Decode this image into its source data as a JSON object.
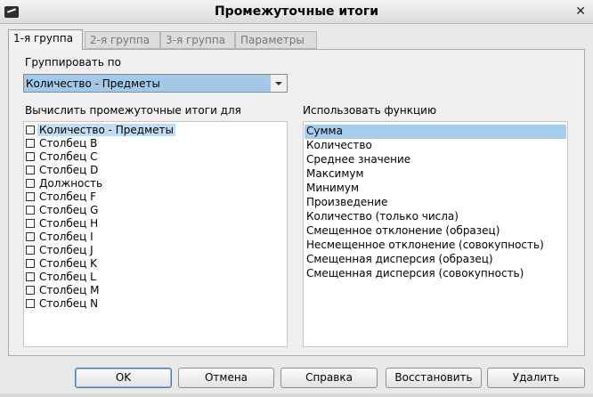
{
  "window": {
    "title": "Промежуточные итоги"
  },
  "tabs": [
    {
      "label": "1-я группа",
      "active": true
    },
    {
      "label": "2-я группа",
      "active": false
    },
    {
      "label": "3-я группа",
      "active": false
    },
    {
      "label": "Параметры",
      "active": false
    }
  ],
  "group_by": {
    "label": "Группировать по",
    "value": "Количество - Предметы"
  },
  "columns": {
    "label": "Вычислить промежуточные итоги для",
    "items": [
      {
        "label": "Количество - Предметы",
        "checked": false,
        "selected": true
      },
      {
        "label": "Столбец B",
        "checked": false
      },
      {
        "label": "Столбец C",
        "checked": false
      },
      {
        "label": "Столбец D",
        "checked": false
      },
      {
        "label": "Должность",
        "checked": false
      },
      {
        "label": "Столбец F",
        "checked": false
      },
      {
        "label": "Столбец G",
        "checked": false
      },
      {
        "label": "Столбец H",
        "checked": false
      },
      {
        "label": "Столбец I",
        "checked": false
      },
      {
        "label": "Столбец J",
        "checked": false
      },
      {
        "label": "Столбец K",
        "checked": false
      },
      {
        "label": "Столбец L",
        "checked": false
      },
      {
        "label": "Столбец M",
        "checked": false
      },
      {
        "label": "Столбец N",
        "checked": false
      }
    ]
  },
  "functions": {
    "label": "Использовать функцию",
    "items": [
      {
        "label": "Сумма",
        "selected": true
      },
      {
        "label": "Количество"
      },
      {
        "label": "Среднее значение"
      },
      {
        "label": "Максимум"
      },
      {
        "label": "Минимум"
      },
      {
        "label": "Произведение"
      },
      {
        "label": "Количество (только числа)"
      },
      {
        "label": "Смещенное отклонение (образец)"
      },
      {
        "label": "Несмещенное отклонение (совокупность)"
      },
      {
        "label": "Смещенная дисперсия (образец)"
      },
      {
        "label": "Смещенная дисперсия (совокупность)"
      }
    ]
  },
  "buttons": {
    "ok": "OK",
    "cancel": "Отмена",
    "help": "Справка",
    "reset": "Восстановить",
    "delete": "Удалить"
  }
}
